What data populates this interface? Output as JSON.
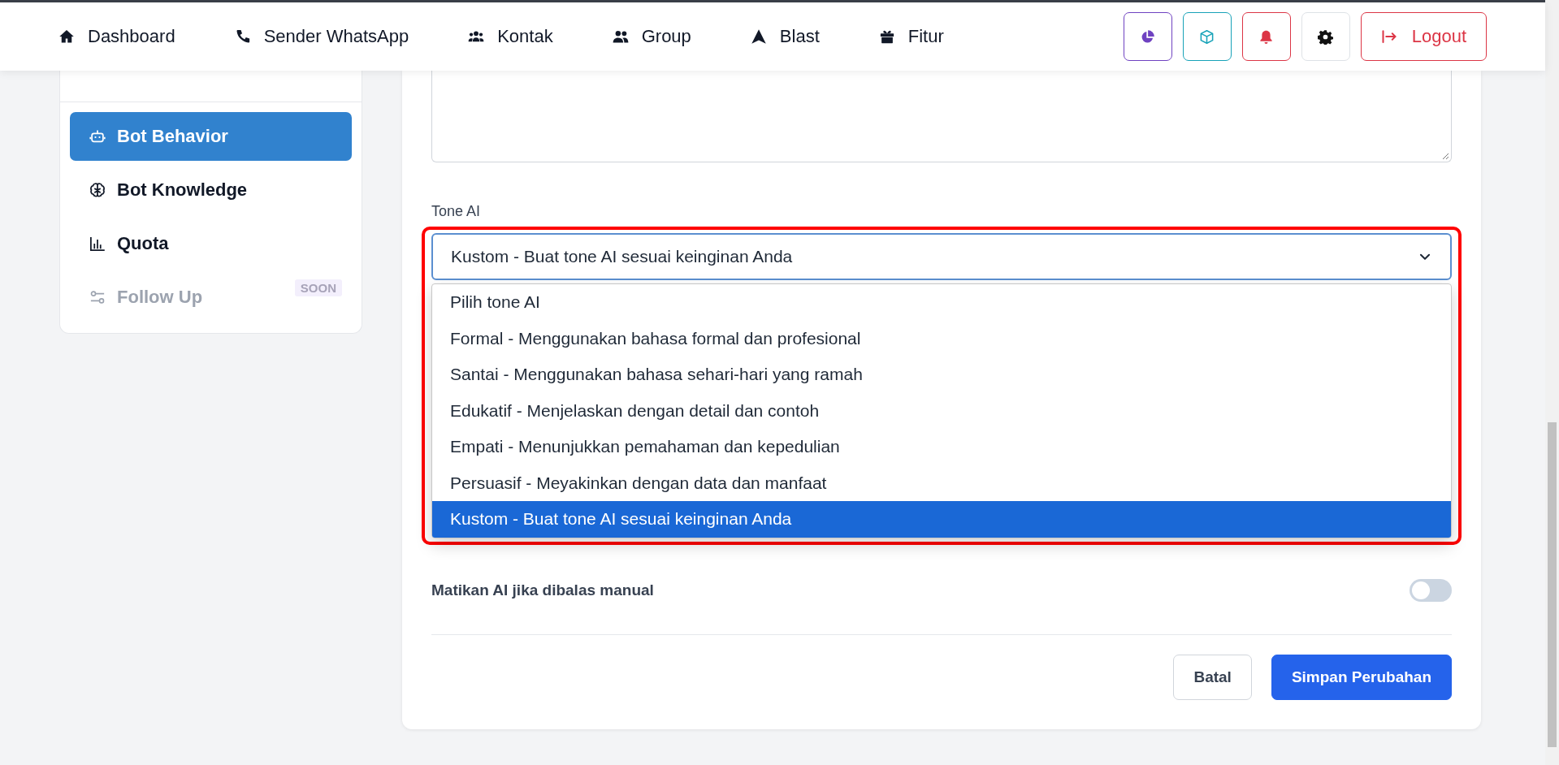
{
  "navbar": {
    "items": [
      {
        "kind": "home",
        "label": "Dashboard"
      },
      {
        "kind": "phone",
        "label": "Sender WhatsApp"
      },
      {
        "kind": "users",
        "label": "Kontak"
      },
      {
        "kind": "group",
        "label": "Group"
      },
      {
        "kind": "blast",
        "label": "Blast"
      },
      {
        "kind": "gift",
        "label": "Fitur"
      }
    ],
    "actions": [
      {
        "kind": "pie",
        "color": "#6f42c1"
      },
      {
        "kind": "cube",
        "color": "#17a2b8"
      },
      {
        "kind": "bell",
        "color": "#dc3545"
      },
      {
        "kind": "gear",
        "color": "#dee2e6"
      }
    ],
    "logout": {
      "label": "Logout"
    }
  },
  "sidebar": {
    "items": [
      {
        "kind": "robot",
        "label": "Bot Behavior",
        "selected": true,
        "disabled": false
      },
      {
        "kind": "brain",
        "label": "Bot Knowledge",
        "selected": false,
        "disabled": false
      },
      {
        "kind": "chart",
        "label": "Quota",
        "selected": false,
        "disabled": false
      },
      {
        "kind": "sliders",
        "label": "Follow Up",
        "selected": false,
        "disabled": true,
        "badge": "SOON"
      }
    ]
  },
  "form": {
    "tone": {
      "label": "Tone AI",
      "value": "Kustom - Buat tone AI sesuai keinginan Anda",
      "expanded": true,
      "options": [
        {
          "label": "Pilih tone AI",
          "selected": false
        },
        {
          "label": "Formal - Menggunakan bahasa formal dan profesional",
          "selected": false
        },
        {
          "label": "Santai - Menggunakan bahasa sehari-hari yang ramah",
          "selected": false
        },
        {
          "label": "Edukatif - Menjelaskan dengan detail dan contoh",
          "selected": false
        },
        {
          "label": "Empati - Menunjukkan pemahaman dan kepedulian",
          "selected": false
        },
        {
          "label": "Persuasif - Meyakinkan dengan data dan manfaat",
          "selected": false
        },
        {
          "label": "Kustom - Buat tone AI sesuai keinginan Anda",
          "selected": true
        }
      ]
    },
    "toggle": {
      "label": "Matikan AI jika dibalas manual",
      "on": false
    },
    "buttons": [
      {
        "kind": "secondary",
        "label": "Batal"
      },
      {
        "kind": "primary",
        "label": "Simpan Perubahan"
      }
    ]
  }
}
